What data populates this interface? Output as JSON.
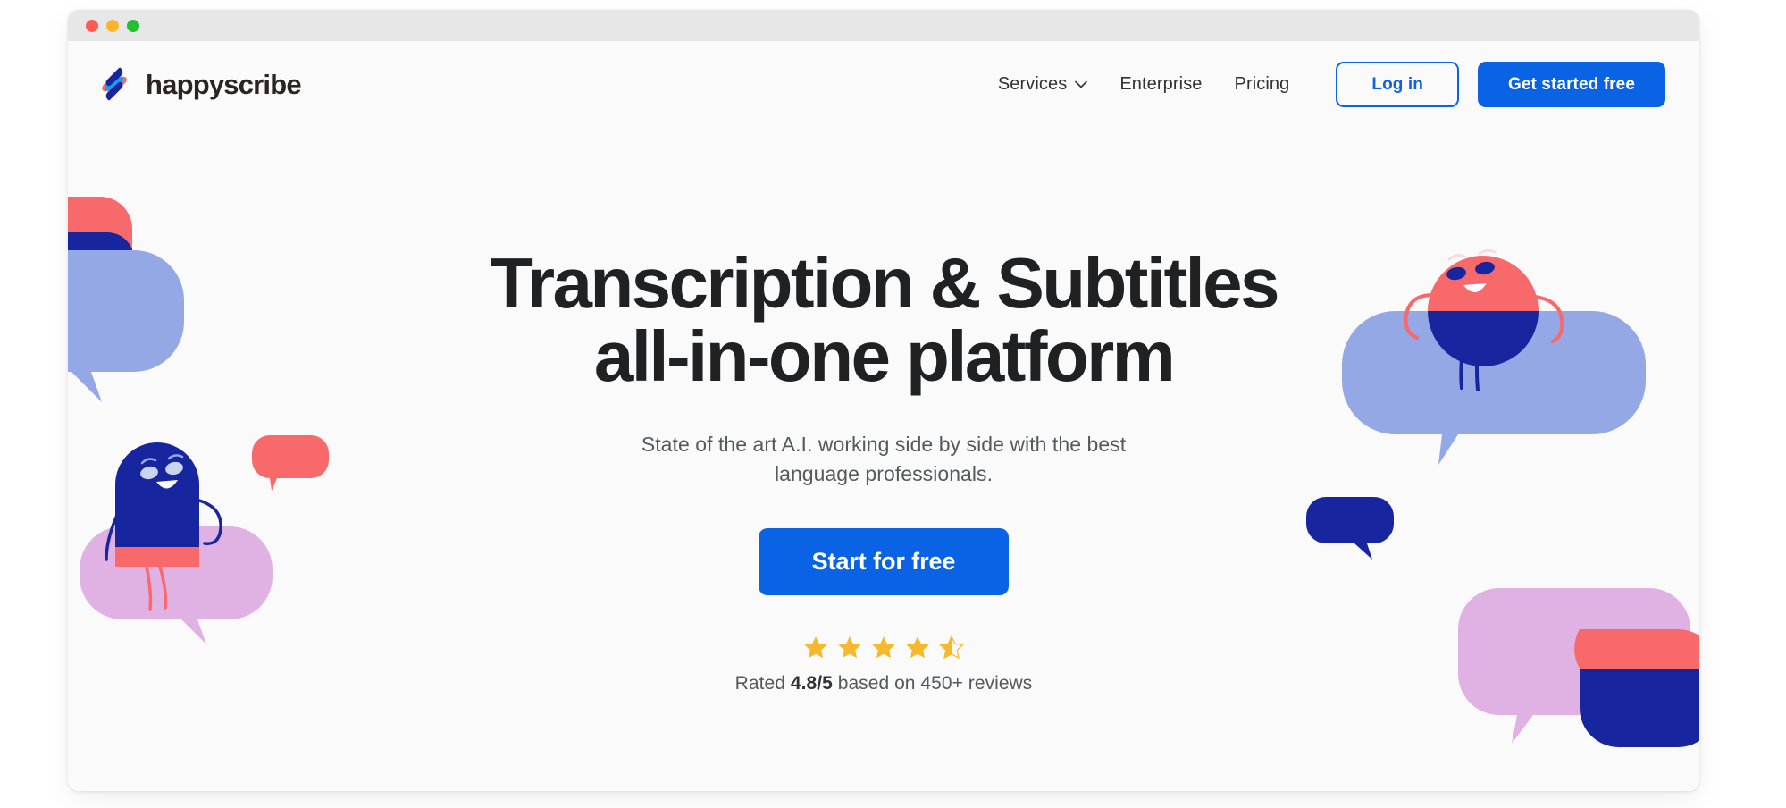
{
  "window": {
    "traffic_lights": [
      {
        "name": "close",
        "color": "#fb5d52"
      },
      {
        "name": "minimize",
        "color": "#f9b42b"
      },
      {
        "name": "maximize",
        "color": "#22c02f"
      }
    ]
  },
  "header": {
    "brand_name": "happyscribe",
    "brand_logo_icon": "happyscribe-logo-icon",
    "nav": [
      {
        "label": "Services",
        "has_dropdown": true,
        "icon": "chevron-down-icon"
      },
      {
        "label": "Enterprise",
        "has_dropdown": false
      },
      {
        "label": "Pricing",
        "has_dropdown": false
      }
    ],
    "login_label": "Log in",
    "signup_label": "Get started free"
  },
  "hero": {
    "title_line1": "Transcription & Subtitles",
    "title_line2": "all-in-one platform",
    "subtitle": "State of the art A.I. working side by side with the best language professionals.",
    "cta_label": "Start for free",
    "rating": {
      "stars_filled": 4,
      "stars_half": 1,
      "stars_total": 5,
      "prefix": "Rated ",
      "score": "4.8/5",
      "suffix": " based on 450+ reviews"
    }
  },
  "colors": {
    "brand_blue": "#0a63e4",
    "navy": "#1a2aa8",
    "light_blue": "#93a8e4",
    "coral": "#f8696b",
    "lavender": "#dfb2e3",
    "cyan": "#1b9cf0",
    "star_gold": "#f5b92b",
    "page_bg": "#fafafa",
    "titlebar_bg": "#e7e7e7",
    "text_dark": "#1f2123",
    "text_muted": "#55595d"
  },
  "illustration": {
    "left": [
      "coral-rounded-shape",
      "navy-rounded-shape",
      "light-blue-speech-bubble",
      "small-coral-speech-bubble",
      "navy-blob-character",
      "lavender-speech-bubble"
    ],
    "right": [
      "coral-circle-character",
      "navy-half-circle",
      "light-blue-speech-bubble",
      "small-navy-speech-bubble",
      "lavender-speech-bubble",
      "coral-navy-rounded-square"
    ]
  }
}
